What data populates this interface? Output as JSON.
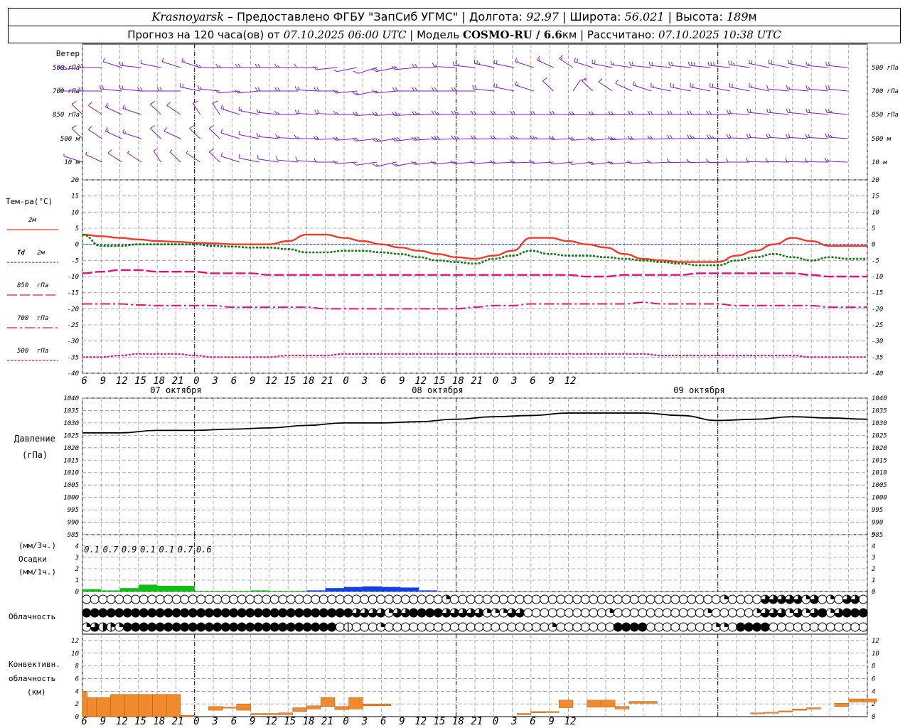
{
  "header": {
    "city": "Krasnoyarsk",
    "provider": "– Предоставлено ФГБУ \"ЗапСиб УГМС\" |",
    "lon_label": "Долгота:",
    "lon": "92.97",
    "sep1": "|",
    "lat_label": "Широта:",
    "lat": "56.021",
    "sep2": "|",
    "alt_label": "Высота:",
    "alt": "189",
    "alt_unit": "м",
    "fc_text": "Прогноз на 120 часа(ов) от",
    "fc_time": "07.10.2025 06:00 UTC",
    "model_label": "| Модель",
    "model": "COSMO-RU / 6.6",
    "model_unit": "км",
    "calc_label": "| Рассчитано:",
    "calc_time": "07.10.2025 10:38 UTC"
  },
  "colors": {
    "t2m": "#ee3b2b",
    "td2m": "#0b7a0b",
    "levels": "#e0117a",
    "wind": "#7a1ccc",
    "pressure": "#000000",
    "precip_a": "#10c010",
    "precip_b": "#1040e0",
    "conv": "#f08a2c",
    "zero": "#1a38d0",
    "grid": "#9a9a9a"
  },
  "wind": {
    "title": "Ветер",
    "levels": [
      "500 гПа",
      "700 гПа",
      "850 гПа",
      "500 м",
      "10 м"
    ],
    "speed_kt": [
      [
        28,
        22,
        12,
        18,
        10,
        12,
        14,
        15,
        16,
        20,
        20,
        15,
        10,
        8,
        6,
        12,
        18,
        22,
        20,
        14,
        24,
        24,
        20,
        16,
        14,
        14,
        20,
        18,
        15,
        18,
        20,
        22,
        30,
        30,
        25,
        20,
        18,
        18,
        15,
        20
      ],
      [
        20,
        18,
        20,
        22,
        22,
        18,
        20,
        16,
        12,
        14,
        18,
        18,
        20,
        18,
        14,
        14,
        16,
        18,
        18,
        20,
        20,
        18,
        20,
        16,
        12,
        10,
        8,
        10,
        10,
        14,
        16,
        20,
        20,
        20,
        18,
        14,
        12,
        14,
        16,
        18
      ],
      [
        10,
        10,
        14,
        16,
        12,
        10,
        10,
        12,
        14,
        14,
        16,
        16,
        20,
        20,
        16,
        18,
        22,
        24,
        26,
        24,
        24,
        22,
        22,
        22,
        22,
        20,
        20,
        22,
        22,
        20,
        18,
        20,
        22,
        22,
        22,
        18,
        18,
        20,
        22,
        24
      ],
      [
        10,
        12,
        14,
        14,
        10,
        10,
        8,
        10,
        12,
        12,
        14,
        14,
        16,
        18,
        18,
        20,
        26,
        28,
        30,
        30,
        26,
        22,
        22,
        24,
        24,
        20,
        18,
        22,
        24,
        22,
        20,
        22,
        24,
        24,
        22,
        18,
        18,
        20,
        22,
        24
      ],
      [
        6,
        6,
        8,
        6,
        6,
        4,
        6,
        8,
        10,
        10,
        10,
        10,
        10,
        10,
        10,
        12,
        14,
        16,
        16,
        16,
        14,
        12,
        14,
        14,
        14,
        12,
        12,
        14,
        16,
        12,
        10,
        12,
        12,
        12,
        12,
        10,
        10,
        10,
        12,
        14
      ]
    ]
  },
  "temp": {
    "title": "Тем-ра(°С)",
    "legend": [
      {
        "label": "2м",
        "key": "t2m"
      },
      {
        "label": "Td",
        "sub": "2м",
        "key": "td2m"
      },
      {
        "label": "850",
        "sub": "гПа",
        "key": "t850"
      },
      {
        "label": "700",
        "sub": "гПа",
        "key": "t700"
      },
      {
        "label": "500",
        "sub": "гПа",
        "key": "t500"
      }
    ],
    "yticks": [
      20,
      15,
      10,
      5,
      0,
      -5,
      -10,
      -15,
      -20,
      -25,
      -30,
      -35,
      -40
    ]
  },
  "pressure": {
    "title": "Давление",
    "unit": "(гПа)",
    "yticks": [
      1040,
      1035,
      1030,
      1025,
      1020,
      1015,
      1010,
      1005,
      1000,
      995,
      990,
      985
    ]
  },
  "precip": {
    "unit1": "(мм/3ч.)",
    "title": "Осадки",
    "unit2": "(мм/1ч.)",
    "yticks": [
      5,
      4,
      3,
      2,
      1,
      0
    ],
    "labels": [
      "0.1",
      "0.7",
      "0.9",
      "0.1",
      "0.1",
      "0.7",
      "0.6"
    ]
  },
  "cloud": {
    "title": "Облачность"
  },
  "conv": {
    "title1": "Конвективн.",
    "title2": "облачность",
    "unit": "(км)",
    "yticks": [
      12,
      10,
      8,
      6,
      4,
      2,
      0
    ]
  },
  "axis": {
    "hour_labels": [
      "6",
      "9",
      "12",
      "15",
      "18",
      "21",
      "0",
      "3",
      "6",
      "9",
      "12",
      "15",
      "18",
      "21",
      "0",
      "3",
      "6",
      "9",
      "12",
      "15",
      "18",
      "21",
      "0",
      "3",
      "6",
      "9",
      "12"
    ],
    "dates": [
      "07 октября",
      "08 октября",
      "09 октября"
    ]
  },
  "chart_data": [
    {
      "type": "line",
      "name": "temperature",
      "x_hours": [
        0,
        3,
        6,
        9,
        12,
        15,
        18,
        21,
        24,
        27,
        30,
        33,
        36,
        39,
        42,
        45,
        48,
        51,
        54,
        57,
        60,
        63,
        66,
        69,
        72,
        75,
        78,
        81,
        84,
        87,
        90,
        93,
        96,
        99,
        102,
        105,
        108,
        111,
        114,
        117,
        120,
        123,
        126
      ],
      "series": [
        {
          "key": "t2m",
          "values": [
            3,
            2.5,
            2,
            1.5,
            1,
            0.8,
            0.5,
            0.3,
            0,
            0,
            0,
            1,
            3,
            3,
            2,
            1,
            0,
            -1,
            -2,
            -3,
            -4,
            -4.5,
            -3.5,
            -2,
            2,
            2,
            1,
            0,
            -1,
            -3,
            -4.5,
            -5,
            -5.5,
            -5.5,
            -5.5,
            -3.5,
            -2,
            0,
            2,
            1,
            -0.5,
            -0.5,
            -0.5
          ]
        },
        {
          "key": "td2m",
          "values": [
            3,
            -0.5,
            -0.5,
            0,
            0,
            0,
            0,
            -0.5,
            -0.7,
            -1,
            -1,
            -1.5,
            -2.5,
            -2.5,
            -2,
            -2,
            -2.5,
            -3,
            -4,
            -5,
            -5.5,
            -6,
            -4.5,
            -3.5,
            -2,
            -3,
            -3.5,
            -3.5,
            -4,
            -4.5,
            -5,
            -5.5,
            -6,
            -6.5,
            -6.5,
            -5,
            -4,
            -3,
            -4,
            -5,
            -4,
            -4.5,
            -4.5
          ]
        },
        {
          "key": "t850",
          "values": [
            -9,
            -8.5,
            -8,
            -8,
            -8.5,
            -8.5,
            -8.5,
            -9,
            -9,
            -9,
            -9.5,
            -9.5,
            -9.5,
            -9.5,
            -9.5,
            -9.5,
            -9.5,
            -9.5,
            -9.5,
            -9.5,
            -9.5,
            -9.5,
            -9.5,
            -9.5,
            -9.5,
            -9.5,
            -9.5,
            -10,
            -10,
            -9.5,
            -9.5,
            -9.5,
            -9.5,
            -9,
            -9,
            -9,
            -9,
            -9,
            -9,
            -9.5,
            -10,
            -10,
            -10
          ]
        },
        {
          "key": "t700",
          "values": [
            -18.5,
            -18.5,
            -18.5,
            -18.8,
            -19,
            -19,
            -19,
            -19,
            -19.5,
            -19.5,
            -19.5,
            -19.5,
            -19.5,
            -20,
            -20,
            -20,
            -20,
            -20,
            -20,
            -20,
            -20,
            -19.5,
            -19,
            -19,
            -18.5,
            -18.5,
            -18.5,
            -18.5,
            -18.5,
            -18.5,
            -18,
            -18.5,
            -18.5,
            -18.5,
            -18.5,
            -19,
            -19,
            -19,
            -19,
            -19,
            -19.5,
            -19.5,
            -19.5
          ]
        },
        {
          "key": "t500",
          "values": [
            -35,
            -35,
            -34.5,
            -34,
            -34,
            -34,
            -34.5,
            -35,
            -35,
            -35,
            -35,
            -34.5,
            -34.5,
            -34.5,
            -34,
            -34,
            -34,
            -34,
            -34,
            -34,
            -34,
            -34,
            -34,
            -34,
            -34,
            -34,
            -34,
            -34,
            -34,
            -34,
            -34,
            -34.5,
            -34.5,
            -34.5,
            -34.5,
            -34.5,
            -34.5,
            -34.5,
            -34.5,
            -35,
            -35,
            -35,
            -35
          ]
        }
      ],
      "xlim": [
        0,
        126
      ],
      "ylim": [
        -40,
        20
      ]
    },
    {
      "type": "line",
      "name": "pressure",
      "x_hours": [
        0,
        6,
        12,
        18,
        24,
        30,
        36,
        42,
        48,
        54,
        60,
        66,
        72,
        78,
        84,
        90,
        96,
        102,
        108,
        114,
        120,
        126
      ],
      "values": [
        1026,
        1026,
        1027,
        1027,
        1027.5,
        1028,
        1029,
        1030,
        1030,
        1030.5,
        1031.5,
        1032.5,
        1033,
        1034,
        1034,
        1034,
        1033,
        1031,
        1031.5,
        1032.5,
        1032,
        1031.5
      ],
      "ylim": [
        985,
        1040
      ],
      "ylabel": "(гПа)"
    },
    {
      "type": "bar",
      "name": "precip",
      "bars": [
        [
          0,
          3,
          0.2,
          "a"
        ],
        [
          3,
          6,
          0.1,
          "a"
        ],
        [
          6,
          9,
          0.3,
          "a"
        ],
        [
          9,
          12,
          0.6,
          "a"
        ],
        [
          12,
          15,
          0.5,
          "a"
        ],
        [
          15,
          18,
          0.5,
          "a"
        ],
        [
          18,
          21,
          0.05,
          "a"
        ],
        [
          21,
          24,
          0.05,
          "a"
        ],
        [
          24,
          27,
          0.05,
          "a"
        ],
        [
          27,
          30,
          0.1,
          "a"
        ],
        [
          30,
          33,
          0.05,
          "a"
        ],
        [
          33,
          36,
          0.05,
          "a"
        ],
        [
          36,
          39,
          0.1,
          "b"
        ],
        [
          39,
          42,
          0.3,
          "b"
        ],
        [
          42,
          45,
          0.4,
          "b"
        ],
        [
          45,
          48,
          0.45,
          "b"
        ],
        [
          48,
          51,
          0.4,
          "b"
        ],
        [
          51,
          54,
          0.35,
          "b"
        ],
        [
          54,
          57,
          0.1,
          "b"
        ]
      ],
      "ylim": [
        0,
        5
      ]
    },
    {
      "type": "table",
      "name": "cloud_cover",
      "rows": [
        "00000000000000000000000000000000000000000000000000000000000000000000000000000000000000000000000000000000000000000000000000000000000000000000000000000000000000000000000000000000000000000000000000000000000000000000000000000000000000000000000000000000000000000000000000000000000000000000000000000000000000000000000000000000000000000000000000000000000000000000000000000000000000000000000000000000000000000",
        "8888888888888888888888888888888888888888888888888888888888888888888888888888888888888888888888888888888888888888888888888888888888888888888888888888888888888888888888888888888888888888888888888888888888888888888888888888888888888888888888888888888888888888888888888888888888888888888888888888888888888888888888888888888888888888888888888888888888888888888888888888888888888888888888888888888888888888888888888",
        "48655888888888888888888888888888888888888888000000000000000000000000000000000000000000000000000000000000000000000000000000000000000000000000000000000000000000000000000000000000000000000000000000000000000000000000000000000000000000000000000000000000000000000000000000000000000000000000000000000000000000000000000000000000000000000000000000000000000000000000000000000000000000000000000000000000000000000"
      ]
    },
    {
      "type": "bar",
      "name": "convective_cloud",
      "bars": [
        [
          0,
          1,
          0,
          4
        ],
        [
          1,
          3,
          0,
          3
        ],
        [
          3,
          6,
          0,
          3
        ],
        [
          6,
          9,
          0,
          3.5
        ],
        [
          9,
          12,
          0,
          3.5
        ],
        [
          12,
          15,
          0,
          3.5
        ],
        [
          15,
          18,
          0,
          3.5
        ],
        [
          18,
          21,
          0,
          3.5
        ],
        [
          21,
          24,
          0,
          0.2
        ],
        [
          27,
          30,
          1,
          1.6
        ],
        [
          30,
          33,
          1.4,
          1.5
        ],
        [
          33,
          36,
          1,
          2
        ],
        [
          36,
          39,
          0.3,
          0.5
        ],
        [
          39,
          42,
          0.3,
          0.5
        ],
        [
          42,
          45,
          0.3,
          0.6
        ],
        [
          45,
          48,
          0.8,
          1.4
        ],
        [
          48,
          51,
          1.2,
          1.7
        ],
        [
          51,
          54,
          1.6,
          3
        ],
        [
          54,
          57,
          1.1,
          1.6
        ],
        [
          57,
          60,
          1.2,
          3
        ],
        [
          60,
          63,
          1.7,
          2
        ],
        [
          63,
          66,
          1.7,
          2
        ],
        [
          93,
          96,
          0.3,
          0.5
        ],
        [
          96,
          99,
          0.6,
          0.8
        ],
        [
          99,
          102,
          0.7,
          0.8
        ],
        [
          102,
          105,
          1.4,
          2.6
        ],
        [
          108,
          111,
          1.5,
          2.6
        ],
        [
          111,
          114,
          1.5,
          2.6
        ],
        [
          114,
          117,
          1.2,
          1.6
        ],
        [
          117,
          120,
          2.1,
          2.4
        ],
        [
          120,
          123,
          2.1,
          2.4
        ],
        [
          143,
          146,
          0.5,
          0.6
        ],
        [
          146,
          149,
          0.6,
          0.7
        ],
        [
          149,
          152,
          0.8,
          0.9
        ],
        [
          152,
          155,
          1,
          1.2
        ],
        [
          155,
          158,
          1.2,
          1.4
        ],
        [
          161,
          164,
          1.6,
          2.1
        ],
        [
          164,
          167,
          2.3,
          2.8
        ],
        [
          167,
          170,
          2.3,
          2.8
        ]
      ],
      "ylim": [
        0,
        13
      ]
    }
  ]
}
